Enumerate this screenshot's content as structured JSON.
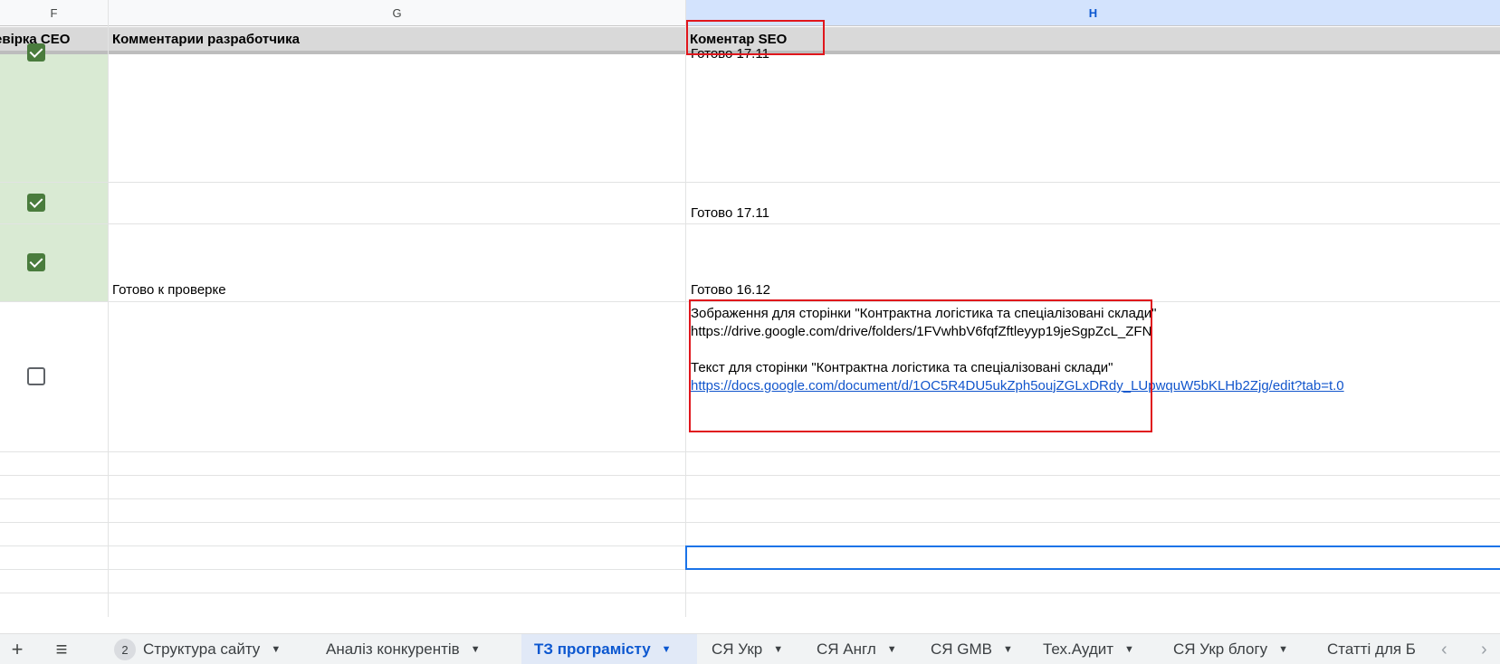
{
  "columns": {
    "f": "F",
    "g": "G",
    "h": "H"
  },
  "header_row": {
    "f": "евірка СЕО",
    "g": "Комментарии разработчика",
    "h": "Коментар SEO"
  },
  "rows": [
    {
      "h_text": "Готово 17.11"
    },
    {
      "h_text": "Готово 17.11"
    },
    {
      "g_text": "Готово к проверке",
      "h_text": "Готово 16.12"
    },
    {
      "h_line1": "Зображення для сторінки \"Контрактна логістика та спеціалізовані склади\"",
      "h_line2": "https://drive.google.com/drive/folders/1FVwhbV6fqfZftleyyp19jeSgpZcL_ZFN",
      "h_line3": "Текст для сторінки \"Контрактна логістика та спеціалізовані склади\"",
      "h_link": "https://docs.google.com/document/d/1OC5R4DU5ukZph5oujZGLxDRdy_LUpwquW5bKLHb2Zjg/edit?tab=t.0"
    }
  ],
  "checkboxes": [
    "checked",
    "checked",
    "checked",
    "unchecked"
  ],
  "tabs": {
    "add_icon": "+",
    "menu_icon": "≡",
    "badge": "2",
    "items": [
      "Структура сайту",
      "Аналіз конкурентів",
      "ТЗ програмісту",
      "СЯ Укр",
      "СЯ Англ",
      "СЯ GMB",
      "Тех.Аудит",
      "СЯ Укр блогу",
      "Статті для Б"
    ],
    "active": "ТЗ програмісту",
    "caret": "▼",
    "prev": "‹",
    "next": "›"
  },
  "colors": {
    "green_cell": "#d9ead3",
    "checkbox": "#4a7c3d",
    "red_highlight": "#e0161c",
    "selection": "#1a73e8",
    "link": "#1155cc"
  }
}
